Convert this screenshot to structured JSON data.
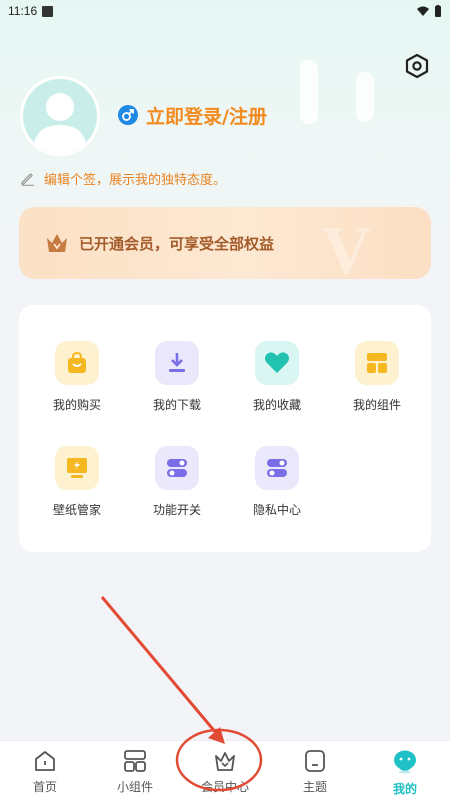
{
  "status_bar": {
    "time": "11:16"
  },
  "profile": {
    "login_text": "立即登录/注册",
    "signature_text": "编辑个签，展示我的独特态度。"
  },
  "vip_banner": {
    "text": "已开通会员，可享受全部权益"
  },
  "features": [
    {
      "label": "我的购买",
      "icon": "shopping-bag-icon",
      "bg": "#fdf1cf",
      "color": "#f5b820"
    },
    {
      "label": "我的下载",
      "icon": "download-icon",
      "bg": "#ebe8fb",
      "color": "#7a6ee6"
    },
    {
      "label": "我的收藏",
      "icon": "heart-icon",
      "bg": "#d9f6f2",
      "color": "#22c2b0"
    },
    {
      "label": "我的组件",
      "icon": "widgets-icon",
      "bg": "#fdf1cf",
      "color": "#f5b820"
    },
    {
      "label": "壁纸管家",
      "icon": "wallpaper-monitor-icon",
      "bg": "#fdf1cf",
      "color": "#f5b820"
    },
    {
      "label": "功能开关",
      "icon": "toggle-icon",
      "bg": "#ebe8fb",
      "color": "#7a6ee6"
    },
    {
      "label": "隐私中心",
      "icon": "privacy-toggle-icon",
      "bg": "#ebe8fb",
      "color": "#7a6ee6"
    }
  ],
  "bottom_nav": [
    {
      "label": "首页",
      "icon": "home-icon",
      "active": false
    },
    {
      "label": "小组件",
      "icon": "widget-icon",
      "active": false
    },
    {
      "label": "会员中心",
      "icon": "crown-icon",
      "active": false
    },
    {
      "label": "主题",
      "icon": "theme-icon",
      "active": false
    },
    {
      "label": "我的",
      "icon": "mascot-icon",
      "active": true
    }
  ],
  "colors": {
    "accent_orange": "#f28a1e",
    "active_teal": "#1fc0c6",
    "annotation_red": "#e24a33"
  }
}
